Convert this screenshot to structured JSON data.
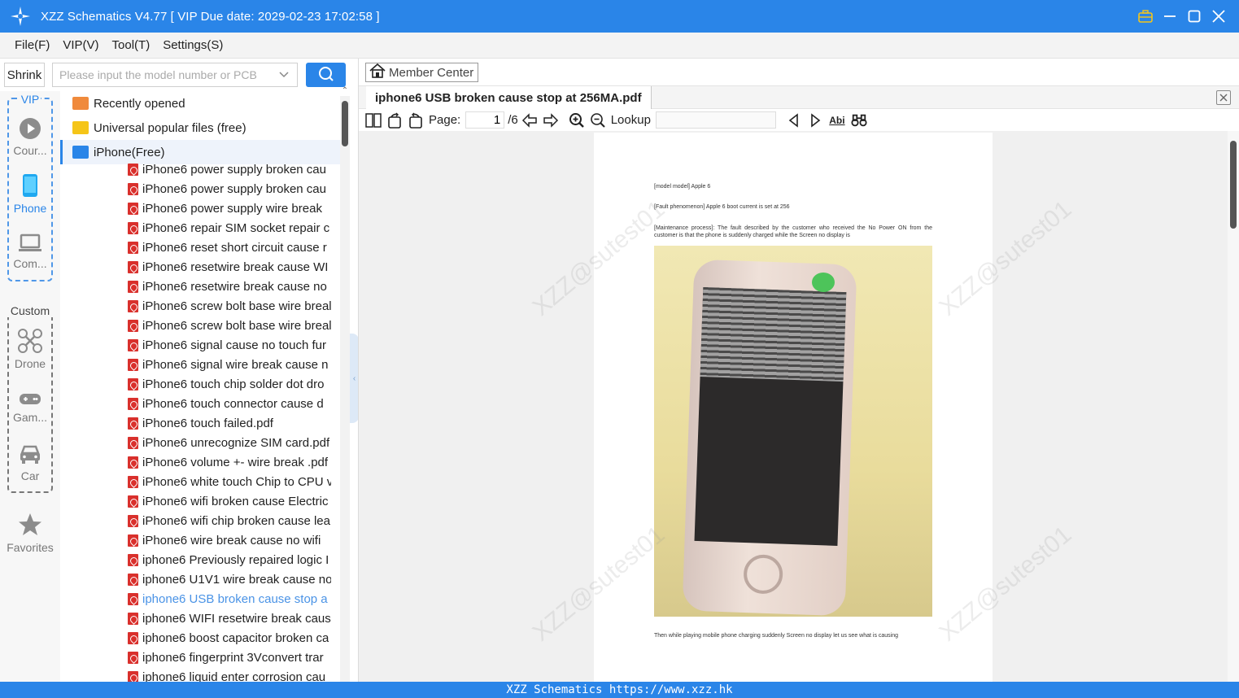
{
  "window": {
    "title": "XZZ Schematics V4.77 [ VIP Due date: 2029-02-23 17:02:58 ]"
  },
  "menu": [
    "File(F)",
    "VIP(V)",
    "Tool(T)",
    "Settings(S)"
  ],
  "left_panel": {
    "shrink_label": "Shrink",
    "vip_label": "VIP",
    "vip_items": [
      {
        "label": "Cour...",
        "icon": "play-circle-icon"
      },
      {
        "label": "Phone",
        "icon": "phone-icon"
      },
      {
        "label": "Com...",
        "icon": "laptop-icon"
      }
    ],
    "custom_label": "Custom",
    "custom_items": [
      {
        "label": "Drone",
        "icon": "drone-icon"
      },
      {
        "label": "Gam...",
        "icon": "gamepad-icon"
      },
      {
        "label": "Car",
        "icon": "car-icon"
      }
    ],
    "favorites_label": "Favorites"
  },
  "search": {
    "placeholder": "Please input the model number or PCB"
  },
  "tree": {
    "top_items": [
      "Recently opened",
      "Universal popular files (free)",
      "iPhone(Free)"
    ],
    "files": [
      "iPhone6 power supply broken cau",
      "iPhone6 power supply broken cau",
      "iPhone6 power supply wire break",
      "iPhone6 repair SIM socket repair c",
      "iPhone6 reset short circuit cause  r",
      "iPhone6 resetwire break  cause WI",
      "iPhone6 resetwire break  cause no",
      "iPhone6 screw bolt base wire breal",
      "iPhone6 screw bolt base wire breal",
      "iPhone6 signal cause no touch fur",
      "iPhone6 signal wire break  cause n",
      "iPhone6 touch chip solder dot dro",
      "iPhone6 touch connector cause  d",
      "iPhone6 touch failed.pdf",
      "iPhone6 unrecognize SIM card.pdf",
      "iPhone6 volume +- wire break .pdf",
      "iPhone6 white touch Chip to CPU v",
      "iPhone6 wifi broken cause Electric",
      "iPhone6 wifi chip broken cause lea",
      "iPhone6 wire break  cause no wifi",
      "iphone6 Previously repaired logic I",
      "iphone6 U1V1 wire break  cause no",
      "iphone6 USB broken cause  stop a",
      "iphone6 WIFI resetwire break  caus",
      "iphone6 boost capacitor broken ca",
      "iphone6 fingerprint 3Vconvert trar",
      "iphone6 liquid enter corrosion cau"
    ],
    "active_index": 22
  },
  "member_center_label": "Member Center",
  "tab": {
    "title": "iphone6 USB broken cause  stop at 256MA.pdf"
  },
  "pdf_toolbar": {
    "page_label": "Page:",
    "page_value": "1",
    "page_total": "/6",
    "lookup_label": "Lookup",
    "abi_label": "Abi"
  },
  "document": {
    "line1": "[model model] Apple 6",
    "line2": "[Fault phenomenon] Apple 6 boot current is set at 256",
    "line3": "[Maintenance process]: The fault described by the customer who received the No Power ON from the customer is that the phone is suddenly charged while the Screen no display is",
    "line4": "Then while playing mobile phone charging suddenly Screen no display let us see what is causing",
    "watermark": "XZZ@sutest01"
  },
  "status_bar": "XZZ Schematics https://www.xzz.hk",
  "colors": {
    "accent": "#2a85e8",
    "folder_orange": "#f08a3c",
    "folder_yellow": "#f5c518",
    "folder_blue": "#2a85e8",
    "pdf_red": "#d9302c"
  }
}
